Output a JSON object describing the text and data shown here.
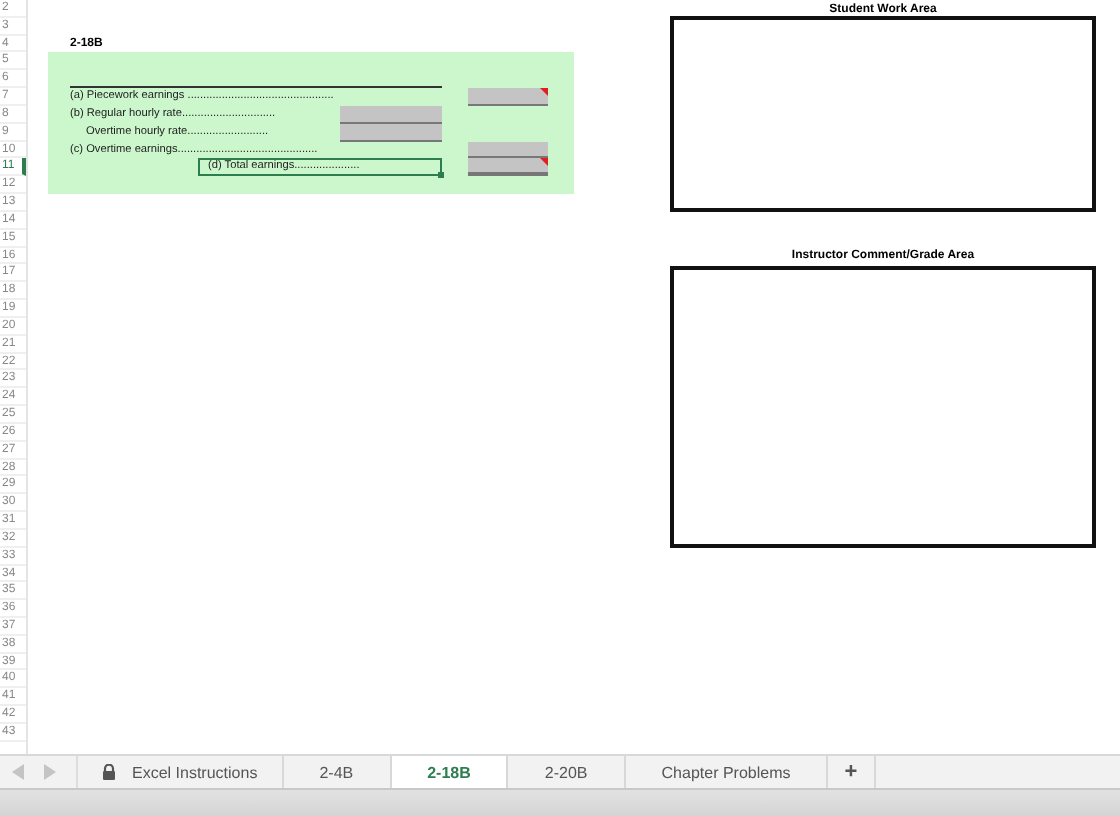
{
  "row_headers": [
    {
      "label": "2",
      "selected": false
    },
    {
      "label": "3",
      "selected": false
    },
    {
      "label": "4",
      "selected": false
    },
    {
      "label": "5",
      "selected": false
    },
    {
      "label": "6",
      "selected": false
    },
    {
      "label": "7",
      "selected": false
    },
    {
      "label": "8",
      "selected": false
    },
    {
      "label": "9",
      "selected": false
    },
    {
      "label": "10",
      "selected": false
    },
    {
      "label": "11",
      "selected": true
    },
    {
      "label": "12",
      "selected": false
    },
    {
      "label": "13",
      "selected": false
    },
    {
      "label": "14",
      "selected": false
    },
    {
      "label": "15",
      "selected": false
    },
    {
      "label": "16",
      "selected": false
    },
    {
      "label": "17",
      "selected": false
    },
    {
      "label": "18",
      "selected": false
    },
    {
      "label": "19",
      "selected": false
    },
    {
      "label": "20",
      "selected": false
    },
    {
      "label": "21",
      "selected": false
    },
    {
      "label": "22",
      "selected": false
    },
    {
      "label": "23",
      "selected": false
    },
    {
      "label": "24",
      "selected": false
    },
    {
      "label": "25",
      "selected": false
    },
    {
      "label": "26",
      "selected": false
    },
    {
      "label": "27",
      "selected": false
    },
    {
      "label": "28",
      "selected": false
    },
    {
      "label": "29",
      "selected": false
    },
    {
      "label": "30",
      "selected": false
    },
    {
      "label": "31",
      "selected": false
    },
    {
      "label": "32",
      "selected": false
    },
    {
      "label": "33",
      "selected": false
    },
    {
      "label": "34",
      "selected": false
    },
    {
      "label": "35",
      "selected": false
    },
    {
      "label": "36",
      "selected": false
    },
    {
      "label": "37",
      "selected": false
    },
    {
      "label": "38",
      "selected": false
    },
    {
      "label": "39",
      "selected": false
    },
    {
      "label": "40",
      "selected": false
    },
    {
      "label": "41",
      "selected": false
    },
    {
      "label": "42",
      "selected": false
    },
    {
      "label": "43",
      "selected": false
    }
  ],
  "problem": {
    "title": "2-18B",
    "lines": [
      {
        "kind": "right",
        "label": "(a) Piecework earnings ...............................................",
        "has_comment": true
      },
      {
        "kind": "middle",
        "label": "(b) Regular hourly rate..............................",
        "has_comment": false
      },
      {
        "kind": "middle-indent",
        "label": "Overtime hourly rate..........................",
        "has_comment": false
      },
      {
        "kind": "right",
        "label": "(c)  Overtime earnings.............................................",
        "has_comment": false
      },
      {
        "kind": "total",
        "label": "(d) Total earnings.....................",
        "has_comment": true
      }
    ]
  },
  "work_areas": [
    {
      "title": "Student Work Area"
    },
    {
      "title": "Instructor Comment/Grade Area"
    }
  ],
  "sheet_tabs": [
    {
      "label": "Excel Instructions",
      "locked": true,
      "selected": false
    },
    {
      "label": "2-4B",
      "locked": false,
      "selected": false
    },
    {
      "label": "2-18B",
      "locked": false,
      "selected": true
    },
    {
      "label": "2-20B",
      "locked": false,
      "selected": false
    },
    {
      "label": "Chapter Problems",
      "locked": false,
      "selected": false
    }
  ],
  "add_tab": "+"
}
